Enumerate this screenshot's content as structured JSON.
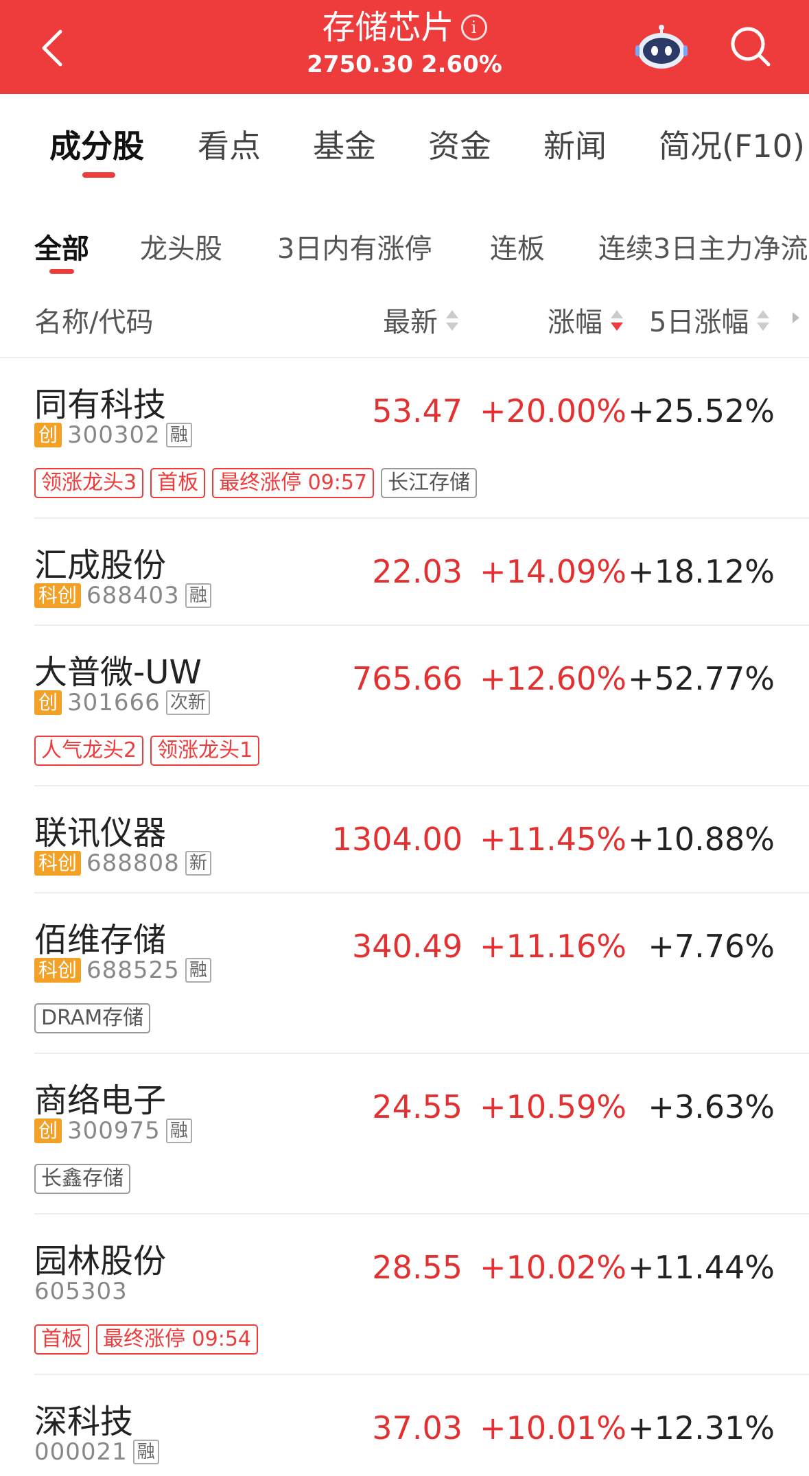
{
  "header": {
    "title": "存储芯片",
    "subtitle": "2750.30 2.60%",
    "info_icon": "info-icon",
    "back_icon": "chevron-left-icon",
    "robot_icon": "robot-icon",
    "search_icon": "search-icon",
    "bg_color": "#ee3b3b"
  },
  "main_tabs": [
    {
      "label": "成分股",
      "active": true
    },
    {
      "label": "看点"
    },
    {
      "label": "基金"
    },
    {
      "label": "资金"
    },
    {
      "label": "新闻"
    },
    {
      "label": "简况(F10)"
    }
  ],
  "filters": [
    {
      "label": "全部",
      "active": true
    },
    {
      "label": "龙头股"
    },
    {
      "label": "3日内有涨停"
    },
    {
      "label": "连板"
    },
    {
      "label": "连续3日主力净流"
    }
  ],
  "columns": {
    "name": "名称/代码",
    "price": "最新",
    "change": "涨幅",
    "change5": "5日涨幅"
  },
  "rows": [
    {
      "name": "同有科技",
      "board": "创",
      "code": "300302",
      "mark": "融",
      "price": "53.47",
      "change": "+20.00%",
      "change5": "+25.52%",
      "tags": [
        {
          "text": "领涨龙头3"
        },
        {
          "text": "首板"
        },
        {
          "text": "最终涨停 09:57"
        },
        {
          "text": "长江存储",
          "gray": true
        }
      ]
    },
    {
      "name": "汇成股份",
      "board": "科创",
      "code": "688403",
      "mark": "融",
      "price": "22.03",
      "change": "+14.09%",
      "change5": "+18.12%",
      "tags": []
    },
    {
      "name": "大普微-UW",
      "board": "创",
      "code": "301666",
      "mark": "次新",
      "price": "765.66",
      "change": "+12.60%",
      "change5": "+52.77%",
      "tags": [
        {
          "text": "人气龙头2"
        },
        {
          "text": "领涨龙头1"
        }
      ]
    },
    {
      "name": "联讯仪器",
      "board": "科创",
      "code": "688808",
      "mark": "新",
      "price": "1304.00",
      "change": "+11.45%",
      "change5": "+10.88%",
      "tags": []
    },
    {
      "name": "佰维存储",
      "board": "科创",
      "code": "688525",
      "mark": "融",
      "price": "340.49",
      "change": "+11.16%",
      "change5": "+7.76%",
      "tags": [
        {
          "text": "DRAM存储",
          "gray": true
        }
      ]
    },
    {
      "name": "商络电子",
      "board": "创",
      "code": "300975",
      "mark": "融",
      "price": "24.55",
      "change": "+10.59%",
      "change5": "+3.63%",
      "tags": [
        {
          "text": "长鑫存储",
          "gray": true
        }
      ]
    },
    {
      "name": "园林股份",
      "board": "",
      "code": "605303",
      "mark": "",
      "price": "28.55",
      "change": "+10.02%",
      "change5": "+11.44%",
      "tags": [
        {
          "text": "首板"
        },
        {
          "text": "最终涨停 09:54"
        }
      ]
    },
    {
      "name": "深科技",
      "board": "",
      "code": "000021",
      "mark": "融",
      "price": "37.03",
      "change": "+10.01%",
      "change5": "+12.31%",
      "tags": []
    }
  ]
}
